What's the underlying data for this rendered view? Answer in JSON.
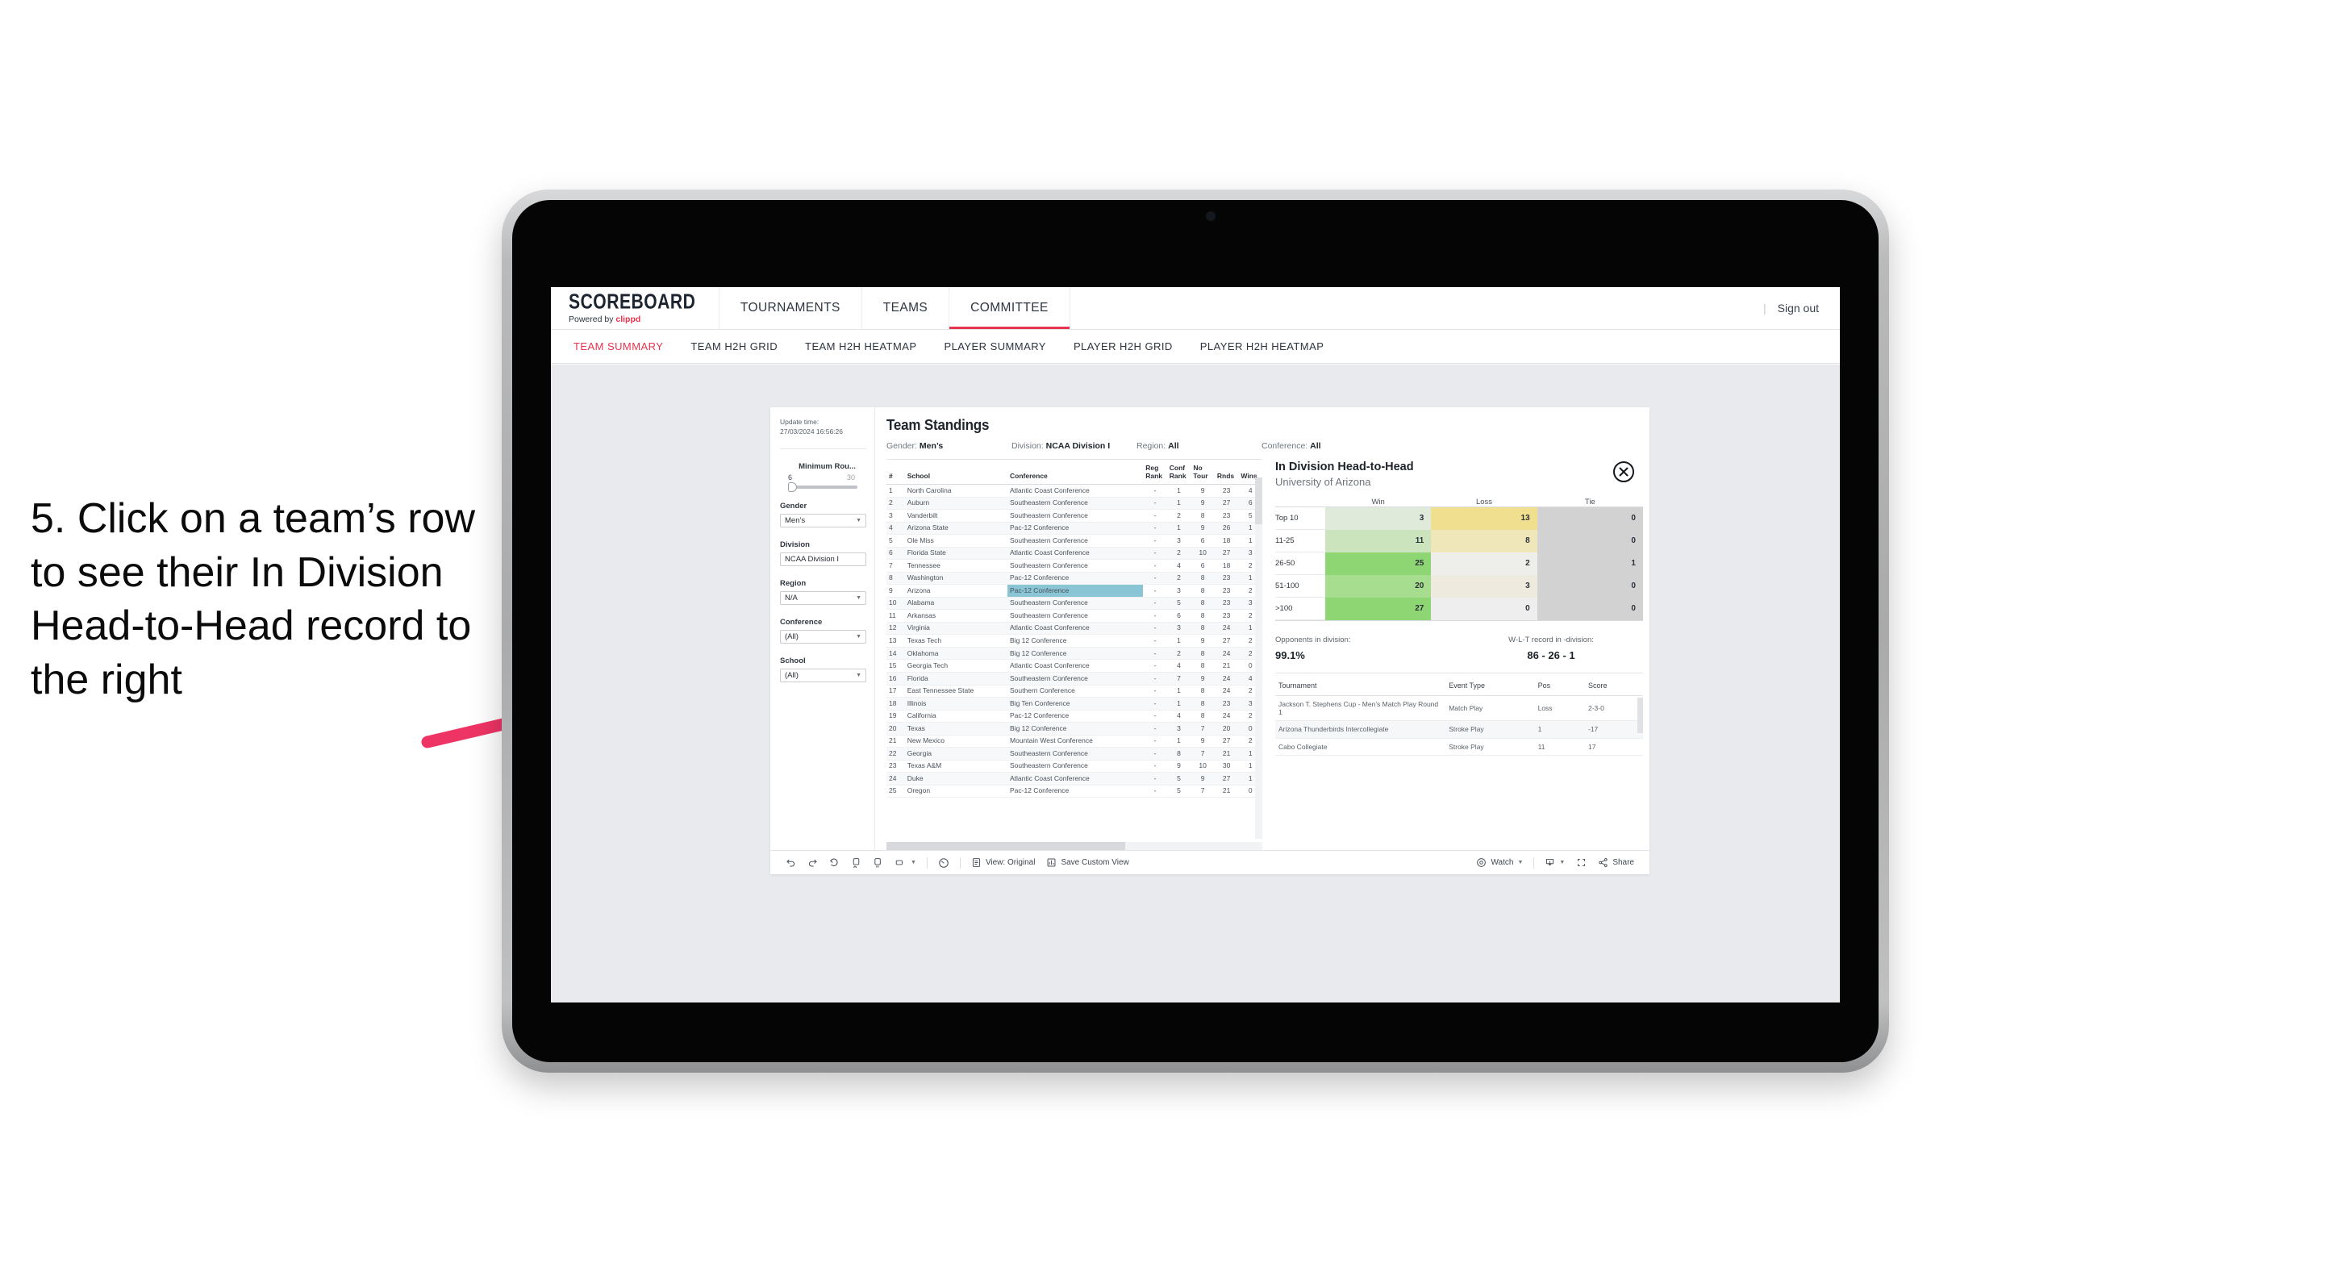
{
  "caption": "5. Click on a team’s row to see their In Division Head-to-Head record to the right",
  "header": {
    "logo_main": "SCOREBOARD",
    "logo_sub_prefix": "Powered by ",
    "logo_sub_brand": "clippd",
    "nav": [
      {
        "label": "TOURNAMENTS",
        "active": false
      },
      {
        "label": "TEAMS",
        "active": false
      },
      {
        "label": "COMMITTEE",
        "active": true
      }
    ],
    "separator": "|",
    "sign_out": "Sign out",
    "accent_color": "#e8344e"
  },
  "subnav": [
    {
      "label": "TEAM SUMMARY",
      "active": true
    },
    {
      "label": "TEAM H2H GRID",
      "active": false
    },
    {
      "label": "TEAM H2H HEATMAP",
      "active": false
    },
    {
      "label": "PLAYER SUMMARY",
      "active": false
    },
    {
      "label": "PLAYER H2H GRID",
      "active": false
    },
    {
      "label": "PLAYER H2H HEATMAP",
      "active": false
    }
  ],
  "filters": {
    "update_label": "Update time:",
    "update_value": "27/03/2024 16:56:26",
    "slider": {
      "title": "Minimum Rou...",
      "min": "6",
      "max": "30"
    },
    "groups": [
      {
        "label": "Gender",
        "value": "Men’s"
      },
      {
        "label": "Division",
        "value": "NCAA Division I"
      },
      {
        "label": "Region",
        "value": "N/A"
      },
      {
        "label": "Conference",
        "value": "(All)"
      },
      {
        "label": "School",
        "value": "(All)"
      }
    ]
  },
  "viz": {
    "title": "Team Standings",
    "summary": [
      {
        "key": "Gender:",
        "value": "Men’s"
      },
      {
        "key": "Division:",
        "value": "NCAA Division I"
      },
      {
        "key": "Region:",
        "value": "All"
      },
      {
        "key": "Conference:",
        "value": "All"
      }
    ]
  },
  "chart_data": {
    "type": "table",
    "title": "Team Standings",
    "columns": [
      "#",
      "School",
      "Conference",
      "Reg Rank",
      "Conf Rank",
      "No Tour",
      "Rnds",
      "Wins"
    ],
    "column_headers_wrapped": [
      {
        "l1": "#",
        "l2": ""
      },
      {
        "l1": "School",
        "l2": ""
      },
      {
        "l1": "Conference",
        "l2": ""
      },
      {
        "l1": "Reg",
        "l2": "Rank"
      },
      {
        "l1": "Conf",
        "l2": "Rank"
      },
      {
        "l1": "No",
        "l2": "Tour"
      },
      {
        "l1": "Rnds",
        "l2": ""
      },
      {
        "l1": "Wins",
        "l2": ""
      }
    ],
    "selected_row_index": 8,
    "selected_cell_color": "#89c5d4",
    "rows": [
      [
        "1",
        "North Carolina",
        "Atlantic Coast Conference",
        "-",
        "1",
        "9",
        "23",
        "4"
      ],
      [
        "2",
        "Auburn",
        "Southeastern Conference",
        "-",
        "1",
        "9",
        "27",
        "6"
      ],
      [
        "3",
        "Vanderbilt",
        "Southeastern Conference",
        "-",
        "2",
        "8",
        "23",
        "5"
      ],
      [
        "4",
        "Arizona State",
        "Pac-12 Conference",
        "-",
        "1",
        "9",
        "26",
        "1"
      ],
      [
        "5",
        "Ole Miss",
        "Southeastern Conference",
        "-",
        "3",
        "6",
        "18",
        "1"
      ],
      [
        "6",
        "Florida State",
        "Atlantic Coast Conference",
        "-",
        "2",
        "10",
        "27",
        "3"
      ],
      [
        "7",
        "Tennessee",
        "Southeastern Conference",
        "-",
        "4",
        "6",
        "18",
        "2"
      ],
      [
        "8",
        "Washington",
        "Pac-12 Conference",
        "-",
        "2",
        "8",
        "23",
        "1"
      ],
      [
        "9",
        "Arizona",
        "Pac-12 Conference",
        "-",
        "3",
        "8",
        "23",
        "2"
      ],
      [
        "10",
        "Alabama",
        "Southeastern Conference",
        "-",
        "5",
        "8",
        "23",
        "3"
      ],
      [
        "11",
        "Arkansas",
        "Southeastern Conference",
        "-",
        "6",
        "8",
        "23",
        "2"
      ],
      [
        "12",
        "Virginia",
        "Atlantic Coast Conference",
        "-",
        "3",
        "8",
        "24",
        "1"
      ],
      [
        "13",
        "Texas Tech",
        "Big 12 Conference",
        "-",
        "1",
        "9",
        "27",
        "2"
      ],
      [
        "14",
        "Oklahoma",
        "Big 12 Conference",
        "-",
        "2",
        "8",
        "24",
        "2"
      ],
      [
        "15",
        "Georgia Tech",
        "Atlantic Coast Conference",
        "-",
        "4",
        "8",
        "21",
        "0"
      ],
      [
        "16",
        "Florida",
        "Southeastern Conference",
        "-",
        "7",
        "9",
        "24",
        "4"
      ],
      [
        "17",
        "East Tennessee State",
        "Southern Conference",
        "-",
        "1",
        "8",
        "24",
        "2"
      ],
      [
        "18",
        "Illinois",
        "Big Ten Conference",
        "-",
        "1",
        "8",
        "23",
        "3"
      ],
      [
        "19",
        "California",
        "Pac-12 Conference",
        "-",
        "4",
        "8",
        "24",
        "2"
      ],
      [
        "20",
        "Texas",
        "Big 12 Conference",
        "-",
        "3",
        "7",
        "20",
        "0"
      ],
      [
        "21",
        "New Mexico",
        "Mountain West Conference",
        "-",
        "1",
        "9",
        "27",
        "2"
      ],
      [
        "22",
        "Georgia",
        "Southeastern Conference",
        "-",
        "8",
        "7",
        "21",
        "1"
      ],
      [
        "23",
        "Texas A&M",
        "Southeastern Conference",
        "-",
        "9",
        "10",
        "30",
        "1"
      ],
      [
        "24",
        "Duke",
        "Atlantic Coast Conference",
        "-",
        "5",
        "9",
        "27",
        "1"
      ],
      [
        "25",
        "Oregon",
        "Pac-12 Conference",
        "-",
        "5",
        "7",
        "21",
        "0"
      ]
    ]
  },
  "h2h": {
    "title": "In Division Head-to-Head",
    "subtitle": "University of Arizona",
    "close_label": "✕",
    "heatmap": {
      "columns": [
        "Win",
        "Loss",
        "Tie"
      ],
      "rows": [
        {
          "label": "Top 10",
          "win": "3",
          "loss": "13",
          "tie": "0",
          "win_color": "#dfeadb",
          "loss_color": "#efdf8e",
          "tie_color": "#d2d2d2"
        },
        {
          "label": "11-25",
          "win": "11",
          "loss": "8",
          "tie": "0",
          "win_color": "#cbe4bd",
          "loss_color": "#efe6b9",
          "tie_color": "#d2d2d2"
        },
        {
          "label": "26-50",
          "win": "25",
          "loss": "2",
          "tie": "1",
          "win_color": "#8ed673",
          "loss_color": "#eeeeea",
          "tie_color": "#d2d2d2"
        },
        {
          "label": "51-100",
          "win": "20",
          "loss": "3",
          "tie": "0",
          "win_color": "#a7dd8e",
          "loss_color": "#efeade",
          "tie_color": "#d2d2d2"
        },
        {
          "label": ">100",
          "win": "27",
          "loss": "0",
          "tie": "0",
          "win_color": "#8ed673",
          "loss_color": "#eeeeee",
          "tie_color": "#d2d2d2"
        }
      ]
    },
    "stats": [
      {
        "key": "Opponents in division:",
        "value": "99.1%"
      },
      {
        "key": "W-L-T record in -division:",
        "value": "86 - 26 - 1"
      }
    ],
    "tournaments": {
      "columns": [
        "Tournament",
        "Event Type",
        "Pos",
        "Score"
      ],
      "rows": [
        [
          "Jackson T. Stephens Cup - Men’s Match Play Round 1",
          "Match Play",
          "Loss",
          "2-3-0"
        ],
        [
          "Arizona Thunderbirds Intercollegiate",
          "Stroke Play",
          "1",
          "-17"
        ],
        [
          "Cabo Collegiate",
          "Stroke Play",
          "11",
          "17"
        ]
      ]
    }
  },
  "toolbar": {
    "undo": "undo-icon",
    "redo": "redo-icon",
    "revert": "revert-icon",
    "refresh": "refresh-data-icon",
    "pause": "pause-updates-icon",
    "view_original_label": "View: Original",
    "save_custom_view_label": "Save Custom View",
    "watch_label": "Watch",
    "share_label": "Share"
  }
}
